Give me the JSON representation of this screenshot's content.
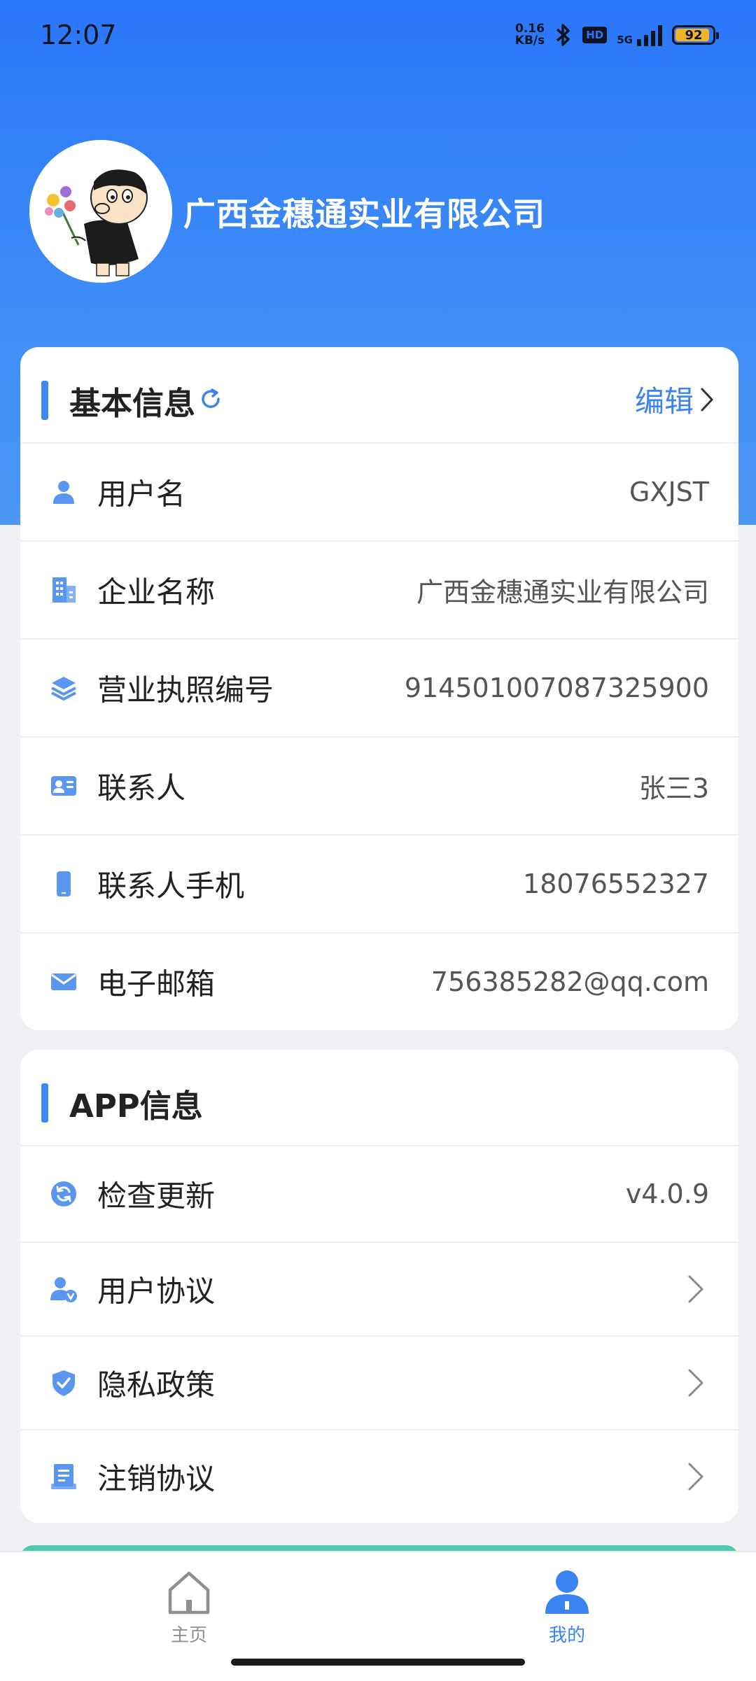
{
  "status_bar": {
    "time": "12:07",
    "net_speed_value": "0.16",
    "net_speed_unit": "KB/s",
    "hd": "HD",
    "network": "5G",
    "battery": "92"
  },
  "profile": {
    "company_title": "广西金穗通实业有限公司"
  },
  "basic_info": {
    "title": "基本信息",
    "edit_label": "编辑",
    "rows": [
      {
        "label": "用户名",
        "value": "GXJST",
        "icon": "user-icon"
      },
      {
        "label": "企业名称",
        "value": "广西金穗通实业有限公司",
        "icon": "building-icon"
      },
      {
        "label": "营业执照编号",
        "value": "914501007087325900",
        "icon": "layers-icon"
      },
      {
        "label": "联系人",
        "value": "张三3",
        "icon": "contact-card-icon"
      },
      {
        "label": "联系人手机",
        "value": "18076552327",
        "icon": "phone-icon"
      },
      {
        "label": "电子邮箱",
        "value": "756385282@qq.com",
        "icon": "mail-icon"
      }
    ]
  },
  "app_info": {
    "title": "APP信息",
    "rows": [
      {
        "label": "检查更新",
        "value": "v4.0.9",
        "icon": "update-icon"
      },
      {
        "label": "用户协议",
        "icon": "user-agreement-icon"
      },
      {
        "label": "隐私政策",
        "icon": "shield-icon"
      },
      {
        "label": "注销协议",
        "icon": "document-icon"
      }
    ]
  },
  "bottom_nav": {
    "home_label": "主页",
    "mine_label": "我的"
  },
  "colors": {
    "accent": "#3a84f1",
    "header_gradient_top": "#2a76f8",
    "header_gradient_bottom": "#4c97f6"
  }
}
